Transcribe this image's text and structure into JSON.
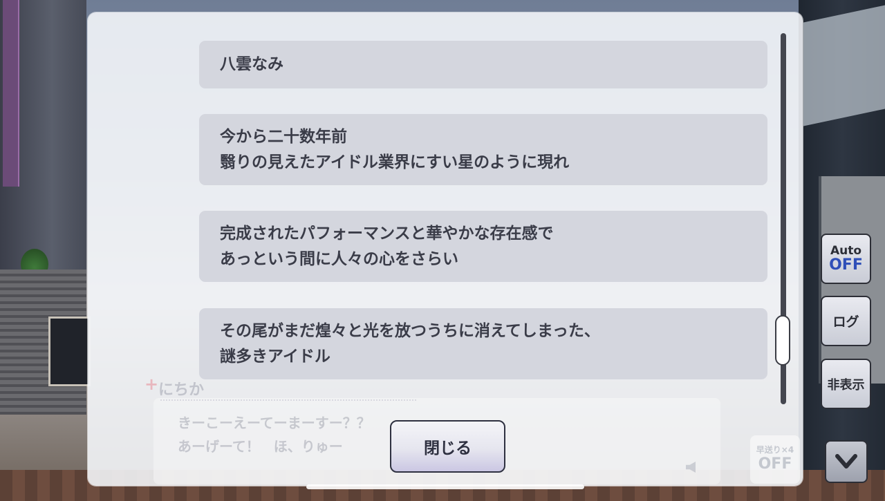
{
  "log": {
    "entries": [
      {
        "text": "八雲なみ"
      },
      {
        "text": "今から二十数年前\n翳りの見えたアイドル業界にすい星のように現れ"
      },
      {
        "text": "完成されたパフォーマンスと華やかな存在感で\nあっという間に人々の心をさらい"
      },
      {
        "text": "その尾がまだ煌々と光を放つうちに消えてしまった、\n謎多きアイドル"
      }
    ],
    "scroll_position": 0.88,
    "close_label": "閉じる"
  },
  "background_message": {
    "speaker": "にちか",
    "line1": "きーこーえーてーまーすー？？",
    "line2": "あーげーて！　ほ、りゅー",
    "fast_forward_label": "早送り×4",
    "fast_forward_value": "OFF"
  },
  "side_controls": {
    "auto_label": "Auto",
    "auto_value": "OFF",
    "log_label": "ログ",
    "hide_label": "非表示",
    "down_icon": "chevron-down-icon"
  }
}
